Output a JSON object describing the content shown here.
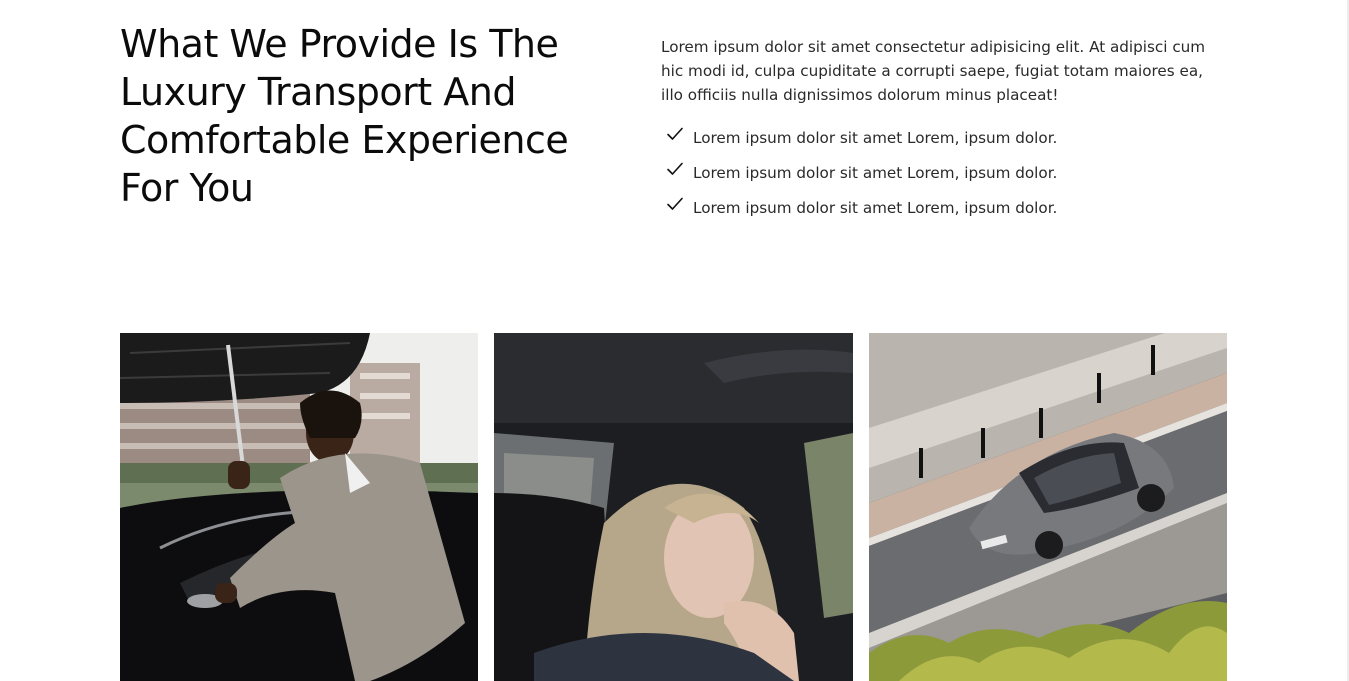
{
  "section": {
    "title": "What We Provide Is The Luxury Transport And Comfortable Experience For You",
    "description": "Lorem ipsum dolor sit amet consectetur adipisicing elit. At adipisci cum hic modi id, culpa cupiditate a corrupti saepe, fugiat totam maiores ea, illo officiis nulla dignissimos dolorum minus placeat!",
    "features": [
      {
        "icon": "check-icon",
        "text": "Lorem ipsum dolor sit amet Lorem, ipsum dolor."
      },
      {
        "icon": "check-icon",
        "text": "Lorem ipsum dolor sit amet Lorem, ipsum dolor."
      },
      {
        "icon": "check-icon",
        "text": "Lorem ipsum dolor sit amet Lorem, ipsum dolor."
      }
    ]
  },
  "gallery": {
    "images": [
      {
        "subject": "chauffeur with umbrella opening black car door"
      },
      {
        "subject": "woman passenger in car back seat"
      },
      {
        "subject": "grey coupe on street from above"
      }
    ]
  }
}
